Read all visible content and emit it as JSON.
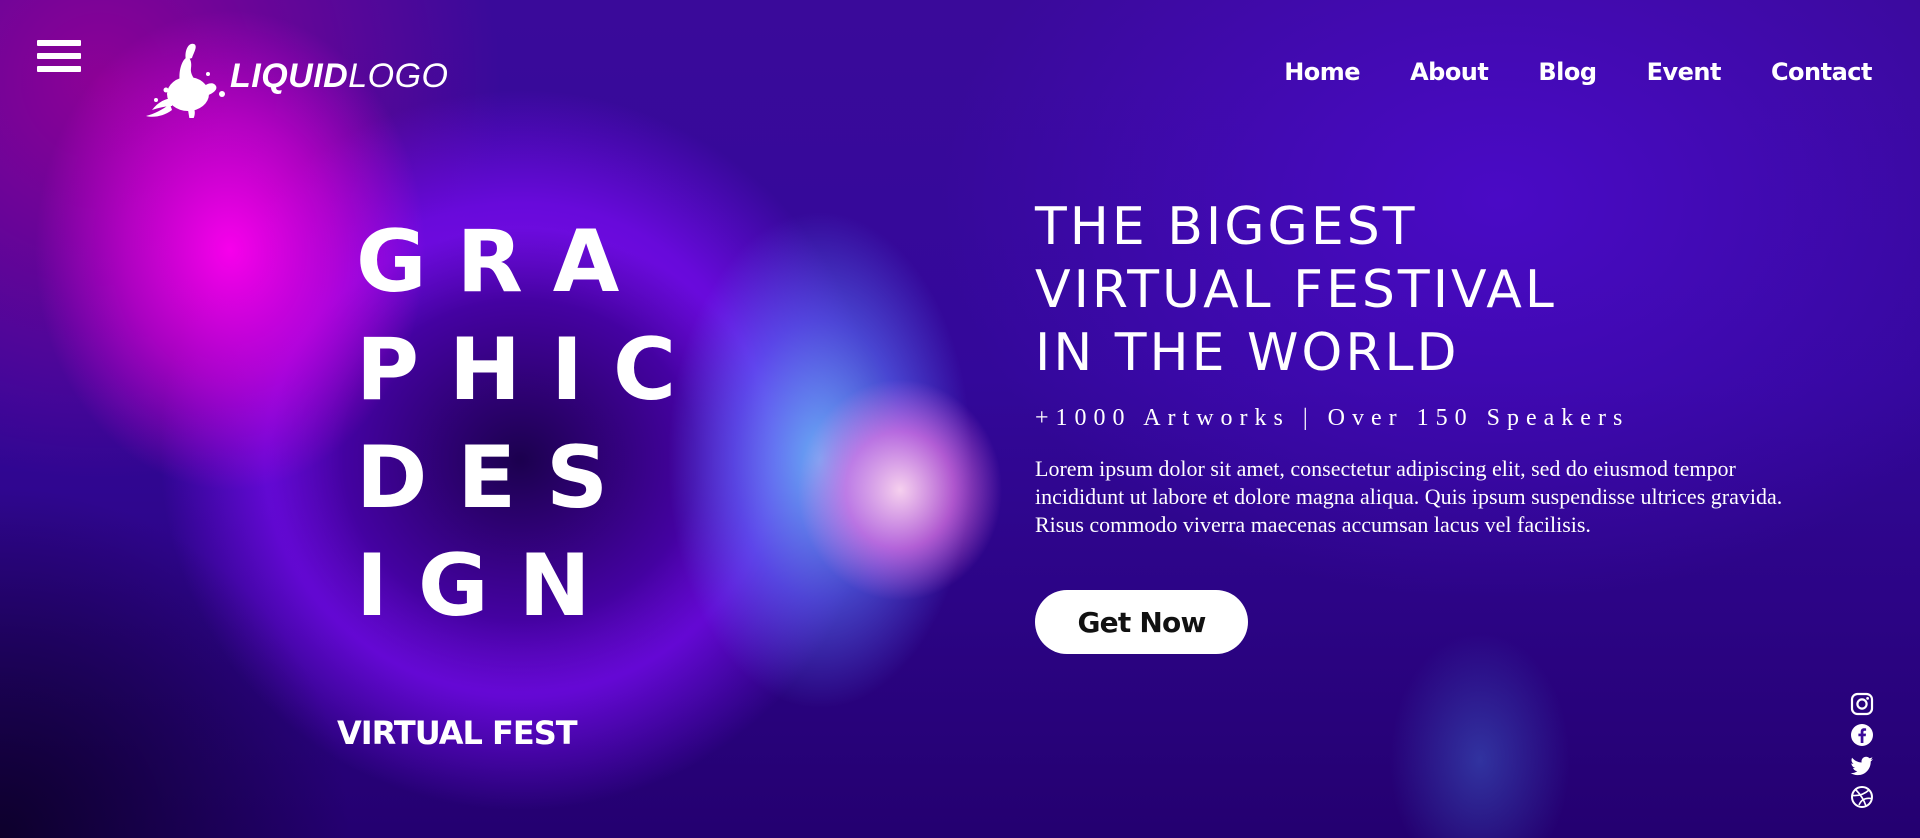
{
  "header": {
    "logo": {
      "bold_text": "LIQUID",
      "light_text": "LOGO",
      "icon": "paint-splash-icon"
    },
    "menu_icon": "hamburger-menu-icon",
    "nav": [
      {
        "label": "Home"
      },
      {
        "label": "About"
      },
      {
        "label": "Blog"
      },
      {
        "label": "Event"
      },
      {
        "label": "Contact"
      }
    ]
  },
  "left": {
    "big_lines": [
      "GRA",
      "PHIC",
      "DES",
      "IGN"
    ],
    "subtitle": "VIRTUAL FEST"
  },
  "hero": {
    "title_lines": [
      "THE BIGGEST",
      "VIRTUAL FESTIVAL",
      "IN THE WORLD"
    ],
    "stats": "+1000 Artworks | Over 150 Speakers",
    "description_lines": [
      "Lorem ipsum dolor sit amet, consectetur adipiscing elit, sed do eiusmod tempor",
      "incididunt ut labore et dolore magna aliqua. Quis ipsum suspendisse ultrices gravida.",
      "Risus commodo viverra maecenas accumsan lacus vel facilisis."
    ],
    "cta_label": "Get Now"
  },
  "social": [
    "instagram-icon",
    "facebook-icon",
    "twitter-icon",
    "dribbble-icon"
  ],
  "colors": {
    "background": "#3a0a9a",
    "accent_magenta": "#ff00f0",
    "accent_violet": "#9614ff",
    "text": "#ffffff",
    "button_bg": "#ffffff",
    "button_text": "#111111"
  }
}
